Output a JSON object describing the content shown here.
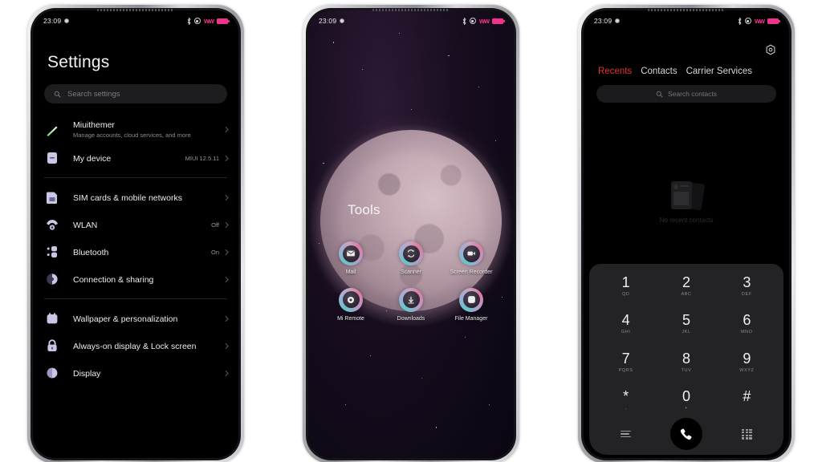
{
  "statusbar": {
    "time": "23:09",
    "alarm_icon": "alarm-icon",
    "bluetooth_icon": "bluetooth-icon",
    "dnd_icon": "dnd-icon",
    "signal_icon": "signal-icon",
    "battery_icon": "battery-icon",
    "accent_color": "#f0338a"
  },
  "phone1": {
    "title": "Settings",
    "search": {
      "placeholder": "Search settings",
      "icon": "search-icon"
    },
    "items": [
      {
        "label": "Miuithemer",
        "sub": "Manage accounts, cloud services, and more",
        "value": "",
        "icon": "comet-icon"
      },
      {
        "label": "My device",
        "sub": "",
        "value": "MIUI 12.5.11",
        "icon": "device-icon"
      },
      {
        "label": "SIM cards & mobile networks",
        "sub": "",
        "value": "",
        "icon": "sim-icon"
      },
      {
        "label": "WLAN",
        "sub": "",
        "value": "Off",
        "icon": "wifi-icon"
      },
      {
        "label": "Bluetooth",
        "sub": "",
        "value": "On",
        "icon": "bluetooth-settings-icon"
      },
      {
        "label": "Connection & sharing",
        "sub": "",
        "value": "",
        "icon": "connection-icon"
      },
      {
        "label": "Wallpaper & personalization",
        "sub": "",
        "value": "",
        "icon": "wallpaper-icon"
      },
      {
        "label": "Always-on display & Lock screen",
        "sub": "",
        "value": "",
        "icon": "lock-icon"
      },
      {
        "label": "Display",
        "sub": "",
        "value": "",
        "icon": "display-icon"
      }
    ],
    "icon_color": "#c9c7e6"
  },
  "phone2": {
    "folder_title": "Tools",
    "apps": [
      {
        "label": "Mail",
        "icon": "mail-icon"
      },
      {
        "label": "Scanner",
        "icon": "scanner-icon"
      },
      {
        "label": "Screen Recorder",
        "icon": "screen-recorder-icon"
      },
      {
        "label": "Mi Remote",
        "icon": "mi-remote-icon"
      },
      {
        "label": "Downloads",
        "icon": "download-icon"
      },
      {
        "label": "File Manager",
        "icon": "file-manager-icon"
      }
    ]
  },
  "phone3": {
    "settings_icon": "gear-icon",
    "tabs": [
      {
        "label": "Recents",
        "active": true
      },
      {
        "label": "Contacts",
        "active": false
      },
      {
        "label": "Carrier Services",
        "active": false
      }
    ],
    "active_tab_color": "#e03434",
    "search": {
      "placeholder": "Search contacts",
      "icon": "search-icon"
    },
    "empty_state": {
      "text": "No recent contacts",
      "icon": "contact-cards-icon"
    },
    "keypad": [
      {
        "digit": "1",
        "sub": "QD"
      },
      {
        "digit": "2",
        "sub": "ABC"
      },
      {
        "digit": "3",
        "sub": "DEF"
      },
      {
        "digit": "4",
        "sub": "GHI"
      },
      {
        "digit": "5",
        "sub": "JKL"
      },
      {
        "digit": "6",
        "sub": "MNO"
      },
      {
        "digit": "7",
        "sub": "PQRS"
      },
      {
        "digit": "8",
        "sub": "TUV"
      },
      {
        "digit": "9",
        "sub": "WXYZ"
      },
      {
        "digit": "*",
        "sub": ","
      },
      {
        "digit": "0",
        "sub": "+"
      },
      {
        "digit": "#",
        "sub": ""
      }
    ],
    "menu_icon": "menu-icon",
    "call_icon": "call-icon",
    "keyboard_icon": "dialpad-toggle-icon"
  }
}
